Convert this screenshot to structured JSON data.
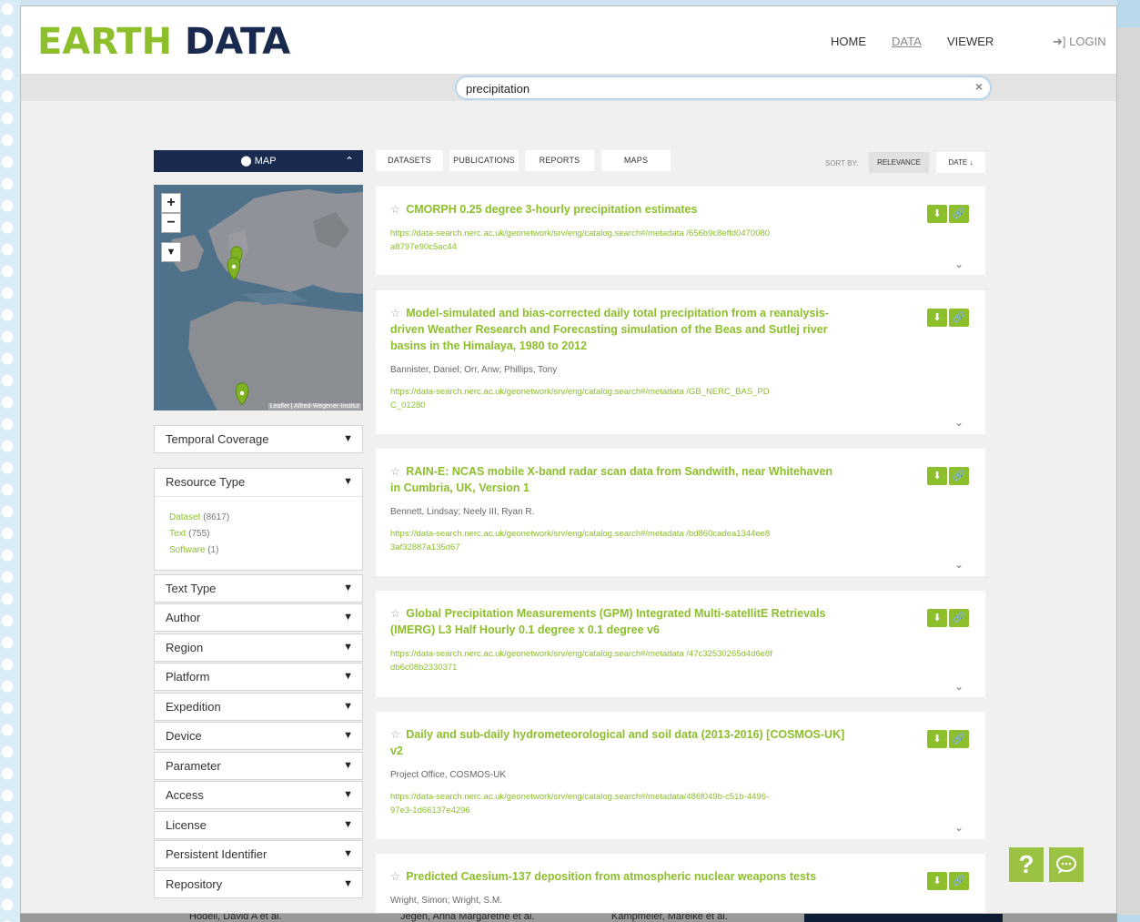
{
  "brand": {
    "part1": "EARTH",
    "part2": "DATA"
  },
  "nav": {
    "home": "HOME",
    "data": "DATA",
    "viewer": "VIEWER",
    "login": "LOGIN"
  },
  "search": {
    "value": "precipitation",
    "clear": "×"
  },
  "sidebar": {
    "map_label": "MAP",
    "map_attribution": "Leaflet | Alfred-Wegener-Institut",
    "facets": {
      "temporal": "Temporal Coverage",
      "resource_type": "Resource Type",
      "resource_options": [
        {
          "label": "Dataset",
          "count": "(8617)"
        },
        {
          "label": "Text",
          "count": "(755)"
        },
        {
          "label": "Software",
          "count": "(1)"
        }
      ],
      "text_type": "Text Type",
      "author": "Author",
      "region": "Region",
      "platform": "Platform",
      "expedition": "Expedition",
      "device": "Device",
      "parameter": "Parameter",
      "access": "Access",
      "license": "License",
      "persistent_identifier": "Persistent Identifier",
      "repository": "Repository"
    }
  },
  "tabs": {
    "datasets": "DATASETS",
    "publications": "PUBLICATIONS",
    "reports": "REPORTS",
    "maps": "MAPS"
  },
  "sort": {
    "label": "SORT BY:",
    "relevance": "RELEVANCE",
    "date": "DATE"
  },
  "results": [
    {
      "title": "CMORPH 0.25 degree 3-hourly precipitation estimates",
      "authors": "",
      "url": "https://data-search.nerc.ac.uk/geonetwork/srv/eng/catalog.search#/metadata /656b9c8effd0470080a8797e90c5ac44"
    },
    {
      "title": "Model-simulated and bias-corrected daily total precipitation from a reanalysis-driven Weather Research and Forecasting simulation of the Beas and Sutlej river basins in the Himalaya, 1980 to 2012",
      "authors": "Bannister, Daniel; Orr, Anw; Phillips, Tony",
      "url": "https://data-search.nerc.ac.uk/geonetwork/srv/eng/catalog.search#/metadata /GB_NERC_BAS_PDC_01280"
    },
    {
      "title": "RAIN-E: NCAS mobile X-band radar scan data from Sandwith, near Whitehaven in Cumbria, UK, Version 1",
      "authors": "Bennett, Lindsay; Neely III, Ryan R.",
      "url": "https://data-search.nerc.ac.uk/geonetwork/srv/eng/catalog.search#/metadata /bd860cadea1344ee83af32887a135d67"
    },
    {
      "title": "Global Precipitation Measurements (GPM) Integrated Multi-satellitE Retrievals (IMERG) L3 Half Hourly 0.1 degree x 0.1 degree v6",
      "authors": "",
      "url": "https://data-search.nerc.ac.uk/geonetwork/srv/eng/catalog.search#/metadata /47c32530265d4d6e8fdb6c08b2330371"
    },
    {
      "title": "Daily and sub-daily hydrometeorological and soil data (2013-2016) [COSMOS-UK] v2",
      "authors": "Project Office, COSMOS-UK",
      "url": "https://data-search.nerc.ac.uk/geonetwork/srv/eng/catalog.search#/metadata/486f049b-c51b-4496-97e3-1d66137e4296"
    },
    {
      "title": "Predicted Caesium-137 deposition from atmospheric nuclear weapons tests",
      "authors": "Wright, Simon; Wright, S.M.",
      "url": ""
    }
  ],
  "background_peek": [
    "Hodell, David A et al.",
    "Jegen, Anna Margarethe et al.",
    "Kampmeier, Mareike et al."
  ],
  "help": {
    "label": "?"
  },
  "colors": {
    "accent": "#8cbf2b",
    "navy": "#1a2a4f"
  }
}
